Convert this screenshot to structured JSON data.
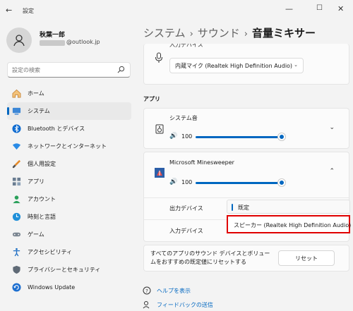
{
  "window": {
    "title": "設定",
    "back_glyph": "←",
    "min_glyph": "—",
    "max_glyph": "☐",
    "close_glyph": "✕"
  },
  "user": {
    "name": "秋葉一郎",
    "email_suffix": "@outlook.jp"
  },
  "search": {
    "placeholder": "設定の検索"
  },
  "sidebar": {
    "items": [
      {
        "label": "ホーム",
        "icon": "home-icon",
        "active": false
      },
      {
        "label": "システム",
        "icon": "system-icon",
        "active": true
      },
      {
        "label": "Bluetooth とデバイス",
        "icon": "bluetooth-icon",
        "active": false
      },
      {
        "label": "ネットワークとインターネット",
        "icon": "network-icon",
        "active": false
      },
      {
        "label": "個人用設定",
        "icon": "personalization-icon",
        "active": false
      },
      {
        "label": "アプリ",
        "icon": "apps-icon",
        "active": false
      },
      {
        "label": "アカウント",
        "icon": "account-icon",
        "active": false
      },
      {
        "label": "時刻と言語",
        "icon": "time-language-icon",
        "active": false
      },
      {
        "label": "ゲーム",
        "icon": "gaming-icon",
        "active": false
      },
      {
        "label": "アクセシビリティ",
        "icon": "accessibility-icon",
        "active": false
      },
      {
        "label": "プライバシーとセキュリティ",
        "icon": "privacy-shield-icon",
        "active": false
      },
      {
        "label": "Windows Update",
        "icon": "windows-update-icon",
        "active": false
      }
    ]
  },
  "breadcrumb": {
    "part1": "システム",
    "part2": "サウンド",
    "current": "音量ミキサー",
    "separator": "›"
  },
  "input_device": {
    "clipped_label": "入力デバイス",
    "selected": "内蔵マイク (Realtek High Definition Audio)",
    "chevron": "⌄"
  },
  "apps_section": {
    "title": "アプリ",
    "items": [
      {
        "name": "システム音",
        "volume": 100,
        "expanded": false,
        "chevron": "⌄"
      },
      {
        "name": "Microsoft Minesweeper",
        "volume": 100,
        "expanded": true,
        "chevron": "⌃"
      }
    ],
    "volume_glyph": "🔊"
  },
  "minesweeper_options": {
    "output_label": "出力デバイス",
    "input_label": "入力デバイス",
    "dropdown_options": [
      "既定",
      "スピーカー (Realtek High Definition Audio)"
    ]
  },
  "reset": {
    "text": "すべてのアプリのサウンド デバイスとボリュームをおすすめの既定値にリセットする",
    "button": "リセット"
  },
  "links": {
    "help": "ヘルプを表示",
    "feedback": "フィードバックの送信"
  },
  "colors": {
    "accent": "#0067c0",
    "highlight_border": "#e00000"
  }
}
